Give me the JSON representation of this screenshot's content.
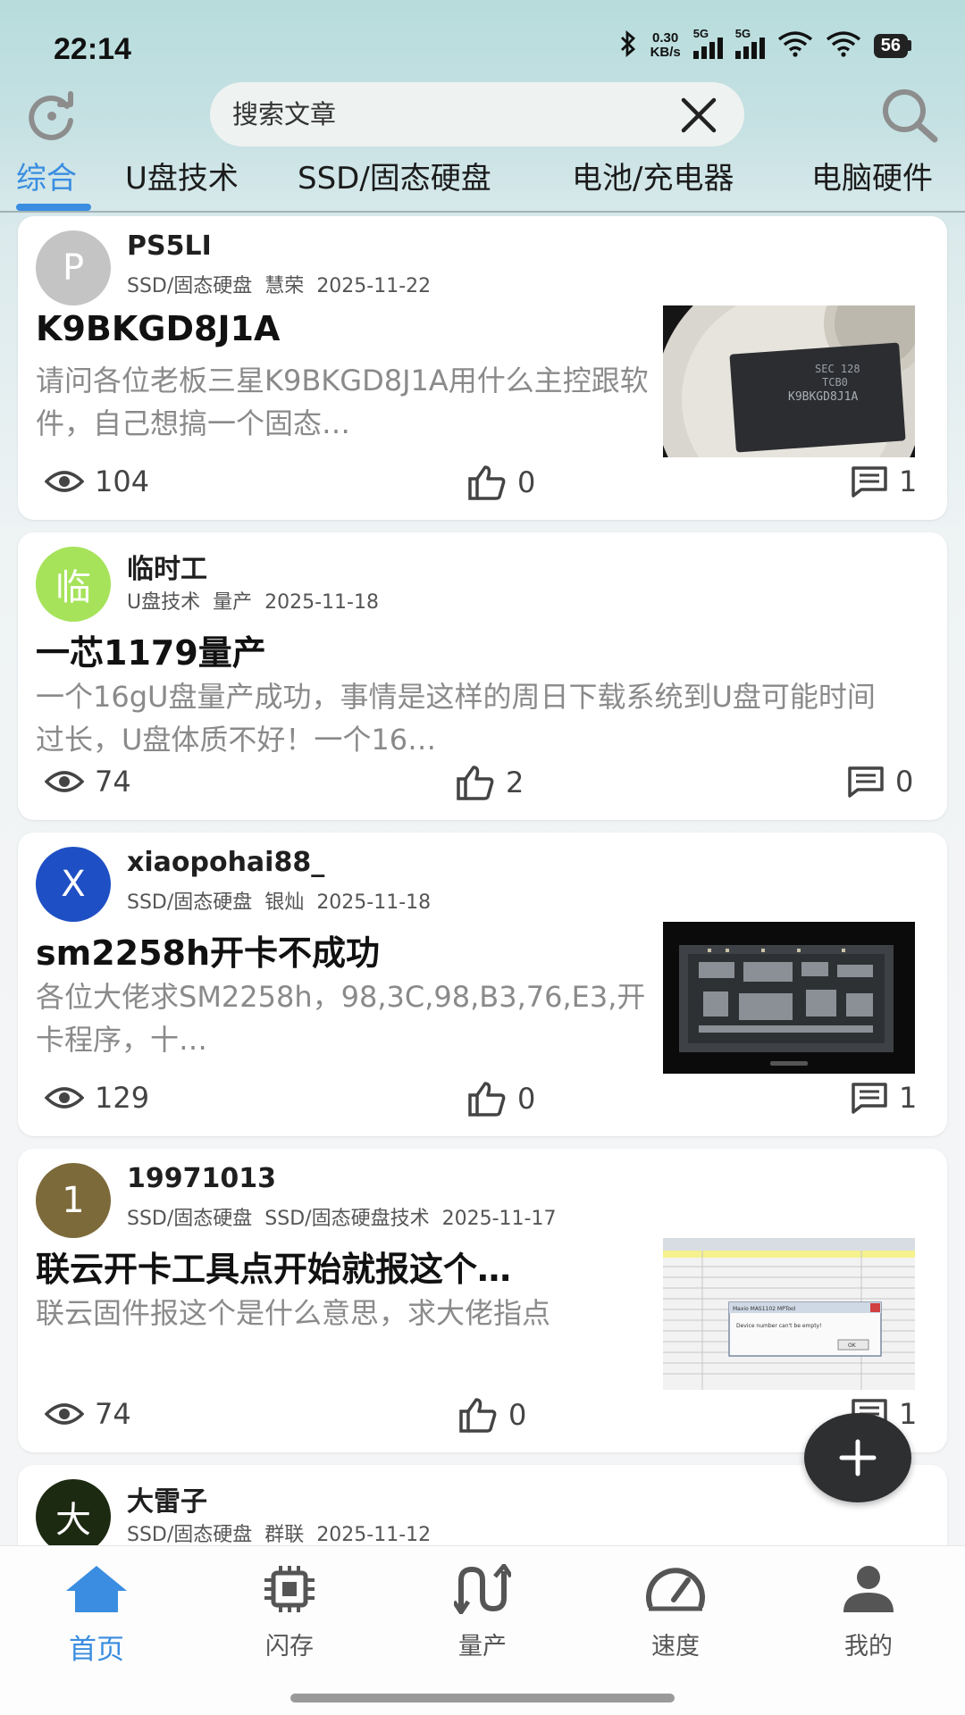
{
  "status_bar": {
    "time": "22:14",
    "net_speed_value": "0.30",
    "net_speed_unit": "KB/s",
    "signal1_label": "5G",
    "signal2_label": "5G",
    "battery": "56"
  },
  "search": {
    "placeholder": "搜索文章",
    "value": "搜索文章"
  },
  "tabs": [
    {
      "label": "综合",
      "active": true
    },
    {
      "label": "U盘技术"
    },
    {
      "label": "SSD/固态硬盘"
    },
    {
      "label": "电池/充电器"
    },
    {
      "label": "电脑硬件"
    }
  ],
  "posts": [
    {
      "avatar_letter": "P",
      "avatar_color": "#c4c4c4",
      "author": "PS5LI",
      "category": "SSD/固态硬盘",
      "subcategory": "慧荣",
      "date": "2025-11-22",
      "title": "K9BKGD8J1A",
      "excerpt": "请问各位老板三星K9BKGD8J1A用什么主控跟软件，自己想搞一个固态…",
      "views": "104",
      "likes": "0",
      "comments": "1",
      "thumbnail": "nand-chip-under-microscope"
    },
    {
      "avatar_letter": "临",
      "avatar_color": "#a6e35b",
      "author": "临时工",
      "category": "U盘技术",
      "subcategory": "量产",
      "date": "2025-11-18",
      "title": "一芯1179量产",
      "excerpt": "一个16gU盘量产成功，事情是这样的周日下载系统到U盘可能时间过长，U盘体质不好！一个16…",
      "views": "74",
      "likes": "2",
      "comments": "0"
    },
    {
      "avatar_letter": "X",
      "avatar_color": "#1f4fc4",
      "author": "xiaopohai88_",
      "category": "SSD/固态硬盘",
      "subcategory": "银灿",
      "date": "2025-11-18",
      "title": "sm2258h开卡不成功",
      "excerpt": "各位大佬求SM2258h，98,3C,98,B3,76,E3,开卡程序，十…",
      "views": "129",
      "likes": "0",
      "comments": "1",
      "thumbnail": "ssd-circuit-board-photo"
    },
    {
      "avatar_letter": "1",
      "avatar_color": "#7d6a3a",
      "author": "19971013",
      "category": "SSD/固态硬盘",
      "subcategory": "SSD/固态硬盘技术",
      "date": "2025-11-17",
      "title": "联云开卡工具点开始就报这个…",
      "excerpt": "联云固件报这个是什么意思，求大佬指点",
      "views": "74",
      "likes": "0",
      "comments": "1",
      "thumbnail": "mptool-error-dialog-screenshot",
      "thumb_dialog_title": "Maxio MAS1102 MPTool",
      "thumb_dialog_text": "Device number can't be empty!",
      "thumb_dialog_ok": "OK"
    },
    {
      "avatar_letter": "大",
      "avatar_color": "#1d2a12",
      "author": "大雷子",
      "category": "SSD/固态硬盘",
      "subcategory": "群联",
      "date": "2025-11-12"
    }
  ],
  "fab_icon": "plus-icon",
  "bottom_nav": [
    {
      "label": "首页",
      "icon": "home-icon",
      "active": true
    },
    {
      "label": "闪存",
      "icon": "chip-icon"
    },
    {
      "label": "量产",
      "icon": "mass-production-icon"
    },
    {
      "label": "速度",
      "icon": "speedometer-icon"
    },
    {
      "label": "我的",
      "icon": "person-icon"
    }
  ],
  "colors": {
    "accent": "#3a8de0",
    "excerpt": "#8a8a8a",
    "fab": "#2d2f31"
  }
}
